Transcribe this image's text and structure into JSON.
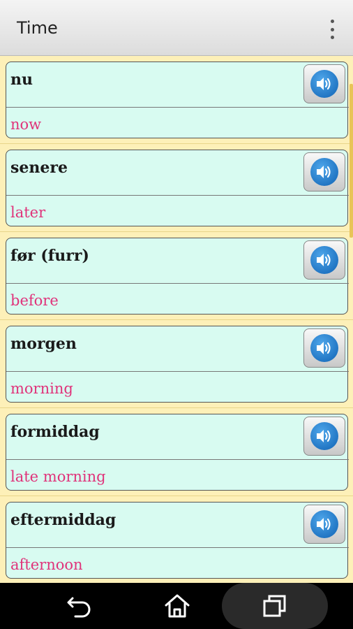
{
  "header": {
    "title": "Time",
    "menu_icon": "more-vert-icon"
  },
  "entries": [
    {
      "word": "nu",
      "translation": "now"
    },
    {
      "word": "senere",
      "translation": "later"
    },
    {
      "word": "før (furr)",
      "translation": "before"
    },
    {
      "word": "morgen",
      "translation": "morning"
    },
    {
      "word": "formiddag",
      "translation": "late morning"
    },
    {
      "word": "eftermiddag",
      "translation": "afternoon"
    }
  ],
  "entry_icon": "speaker-icon",
  "colors": {
    "background": "#fdf0b8",
    "card": "#d8fbf1",
    "translation": "#e0337a",
    "speaker": "#1d74c8"
  },
  "nav": {
    "back_icon": "back-icon",
    "home_icon": "home-icon",
    "recents_icon": "recent-apps-icon"
  }
}
